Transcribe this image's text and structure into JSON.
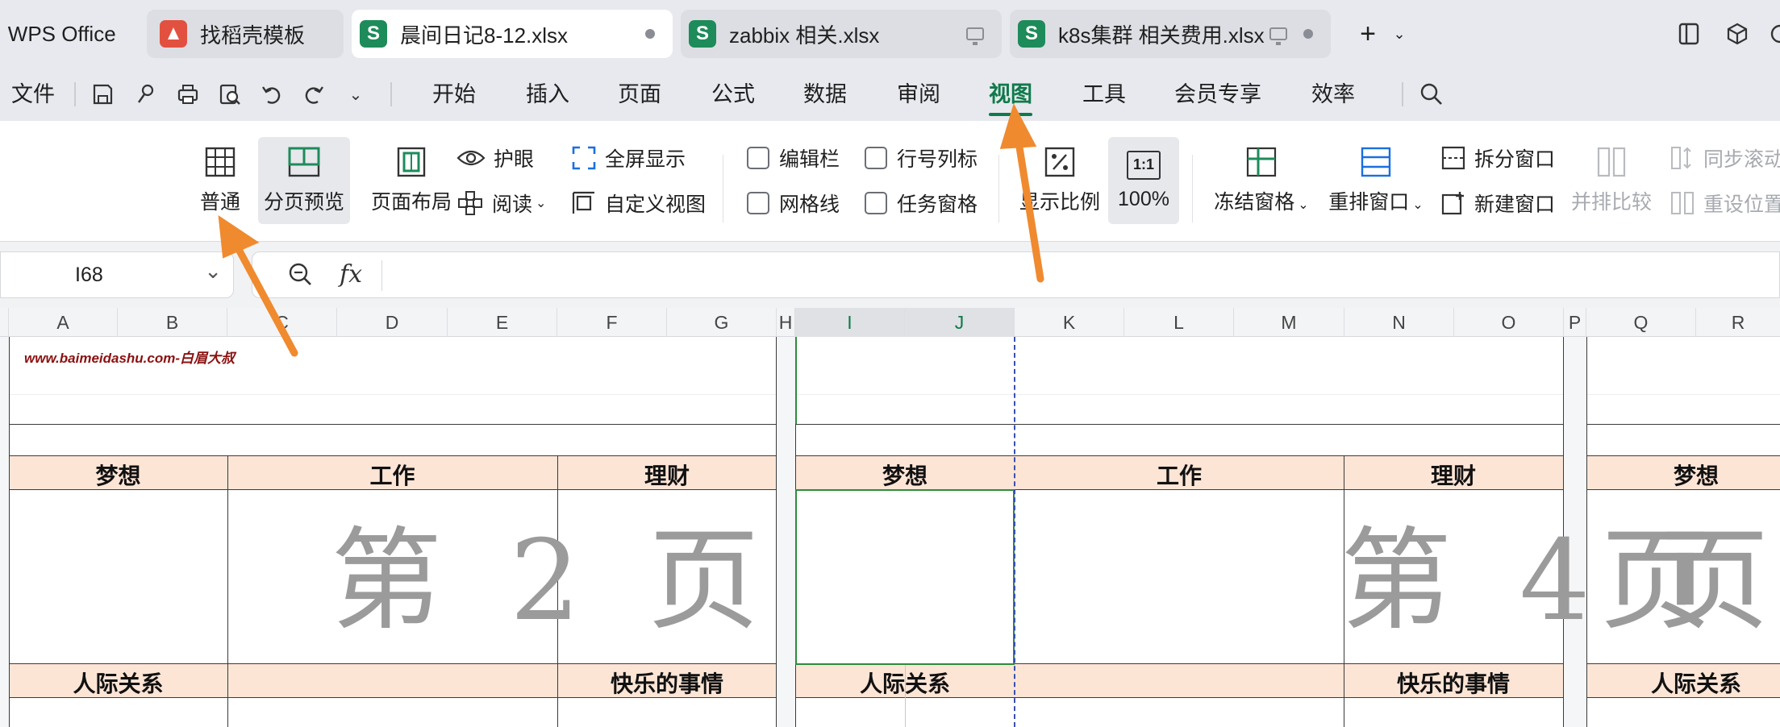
{
  "tabs": [
    {
      "label": "WPS Office",
      "icon": "wps-logo"
    },
    {
      "label": "找稻壳模板",
      "icon": "docer-logo"
    },
    {
      "label": "晨间日记8-12.xlsx",
      "icon": "sheet-logo",
      "active": true
    },
    {
      "label": "zabbix 相关.xlsx",
      "icon": "sheet-logo"
    },
    {
      "label": "k8s集群 相关费用.xlsx",
      "icon": "sheet-logo"
    }
  ],
  "sheet_icon_letter": "S",
  "new_tab": "+",
  "menu": {
    "file": "文件",
    "items": [
      "开始",
      "插入",
      "页面",
      "公式",
      "数据",
      "审阅",
      "视图",
      "工具",
      "会员专享",
      "效率"
    ],
    "selected": "视图"
  },
  "ribbon": {
    "normal": "普通",
    "page_break_preview": "分页预览",
    "page_layout": "页面布局",
    "eye_protection": "护眼",
    "reading": "阅读",
    "fullscreen": "全屏显示",
    "custom_view": "自定义视图",
    "formula_bar": "编辑栏",
    "headings": "行号列标",
    "gridlines": "网格线",
    "task_pane": "任务窗格",
    "zoom": "显示比例",
    "zoom_100": "100%",
    "zoom_100_icon": "1:1",
    "freeze_panes": "冻结窗格",
    "arrange": "重排窗口",
    "split": "拆分窗口",
    "new_window": "新建窗口",
    "side_by_side": "并排比较",
    "sync_scroll": "同步滚动",
    "reset_position": "重设位置"
  },
  "checkbox_state": {
    "formula_bar": true,
    "headings": true,
    "gridlines": true,
    "task_pane": false
  },
  "formula": {
    "name_box": "I68",
    "fx_label": "fx",
    "value": ""
  },
  "columns": [
    "A",
    "B",
    "C",
    "D",
    "E",
    "F",
    "G",
    "H",
    "I",
    "J",
    "K",
    "L",
    "M",
    "N",
    "O",
    "P",
    "Q",
    "R"
  ],
  "selected_columns": [
    "I",
    "J"
  ],
  "sheet": {
    "site_text": "www.baimeidashu.com-白眉大叔",
    "headers_row1": [
      "梦想",
      "工作",
      "理财"
    ],
    "headers_row2": [
      "人际关系",
      "",
      "快乐的事情"
    ],
    "page_labels": [
      "第 2 页",
      "第 4 页"
    ],
    "partial_page_label": "页"
  },
  "colors": {
    "accent": "#0f7a4b",
    "header_band": "#fde5d6",
    "arrow": "#f08a2f",
    "checkbox": "#1a6fe0"
  }
}
